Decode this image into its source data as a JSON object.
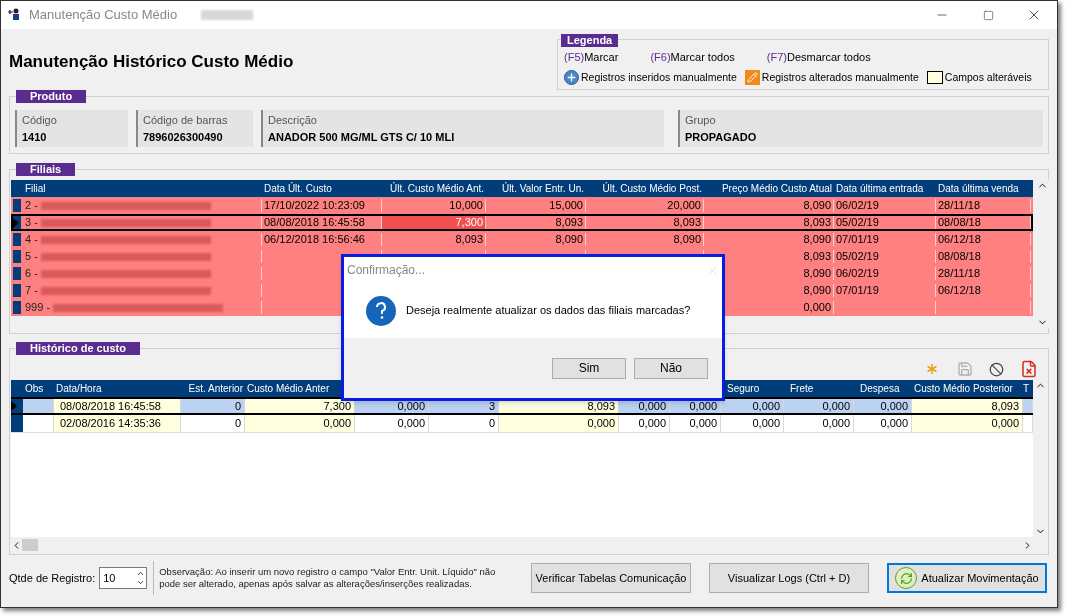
{
  "window": {
    "title": "Manutenção Custo Médio",
    "user_blurred": true
  },
  "heading": "Manutenção Histórico Custo Médio",
  "legend": {
    "title": "Legenda",
    "shortcuts": [
      {
        "key": "(F5)",
        "label": "Marcar"
      },
      {
        "key": "(F6)",
        "label": "Marcar todos"
      },
      {
        "key": "(F7)",
        "label": "Desmarcar todos"
      }
    ],
    "items": [
      {
        "kind": "inserted",
        "label": "Registros inseridos manualmente"
      },
      {
        "kind": "altered",
        "label": "Registros alterados manualmente"
      },
      {
        "kind": "editable",
        "label": "Campos alteráveis"
      }
    ]
  },
  "produto": {
    "title": "Produto",
    "fields": [
      {
        "label": "Código",
        "value": "1410"
      },
      {
        "label": "Código de barras",
        "value": "7896026300490"
      },
      {
        "label": "Descrição",
        "value": "ANADOR 500 MG/ML GTS C/ 10 MLI"
      },
      {
        "label": "Grupo",
        "value": "PROPAGADO"
      }
    ]
  },
  "filiais": {
    "title": "Filiais",
    "columns": [
      "Filial",
      "Data Últ. Custo",
      "Últ. Custo Médio Ant.",
      "Últ. Valor Entr. Un.",
      "Últ. Custo Médio Post.",
      "Preço Médio Custo Atual",
      "Data última entrada",
      "Data última venda"
    ],
    "rows": [
      {
        "selected": false,
        "marked": true,
        "name_blurred": true,
        "cells": [
          "2 -",
          "17/10/2022 10:23:09",
          "10,000",
          "15,000",
          "20,000",
          "8,090",
          "06/02/19",
          "28/11/18"
        ]
      },
      {
        "selected": true,
        "marked": true,
        "name_blurred": true,
        "cells": [
          "3 -",
          "08/08/2018 16:45:58",
          {
            "text": "7,300",
            "changed": true
          },
          "8,093",
          "8,093",
          "8,093",
          "05/02/19",
          "08/08/18"
        ]
      },
      {
        "selected": false,
        "marked": true,
        "name_blurred": true,
        "cells": [
          "4 -",
          "06/12/2018 16:56:46",
          "8,093",
          "8,090",
          "8,090",
          "8,090",
          "07/01/19",
          "06/12/18"
        ]
      },
      {
        "selected": false,
        "marked": true,
        "name_blurred": true,
        "cells": [
          "5 -",
          null,
          null,
          null,
          null,
          "8,093",
          "05/02/19",
          "08/08/18"
        ]
      },
      {
        "selected": false,
        "marked": true,
        "name_blurred": true,
        "cells": [
          "6 -",
          null,
          null,
          null,
          null,
          "8,090",
          "06/02/19",
          "28/11/18"
        ]
      },
      {
        "selected": false,
        "marked": true,
        "name_blurred": true,
        "cells": [
          "7 -",
          null,
          null,
          null,
          null,
          "8,090",
          "07/01/19",
          "06/12/18"
        ]
      },
      {
        "selected": false,
        "marked": true,
        "name_blurred": true,
        "cells": [
          "999 -",
          null,
          null,
          null,
          null,
          "0,000",
          null,
          null
        ]
      }
    ]
  },
  "historico": {
    "title": "Histórico de custo",
    "toolbar": [
      {
        "kind": "new",
        "disabled": false
      },
      {
        "kind": "save",
        "disabled": true
      },
      {
        "kind": "cancel",
        "disabled": false
      },
      {
        "kind": "delete",
        "disabled": false
      }
    ],
    "columns": [
      {
        "label": "Obs",
        "editable": false
      },
      {
        "label": "Data/Hora",
        "editable": true
      },
      {
        "label": "Est. Anterior",
        "editable": false
      },
      {
        "label": "Custo Médio Anter",
        "editable": true
      },
      {
        "editable": false
      },
      {
        "editable": false
      },
      {
        "editable": true
      },
      {
        "editable": false
      },
      {
        "editable": false
      },
      {
        "label": "Seguro",
        "editable": false
      },
      {
        "label": "Frete",
        "editable": false
      },
      {
        "label": "Despesa",
        "editable": false
      },
      {
        "label": "Custo Médio Posterior",
        "editable": true
      },
      {
        "label": "T",
        "editable": false
      }
    ],
    "rows": [
      {
        "selected": true,
        "cells": [
          null,
          "08/08/2018 16:45:58",
          "0",
          "7,300",
          "0,000",
          "3",
          "8,093",
          "0,000",
          "0,000",
          "0,000",
          "0,000",
          "0,000",
          "8,093",
          null
        ]
      },
      {
        "selected": false,
        "cells": [
          null,
          "02/08/2016 14:35:36",
          "0",
          "0,000",
          "0,000",
          "0",
          "0,000",
          "0,000",
          "0,000",
          "0,000",
          "0,000",
          "0,000",
          "0,000",
          null
        ]
      }
    ]
  },
  "footer": {
    "qtde_label": "Qtde de Registro:",
    "qtde_value": "10",
    "note": "Observação:  Ao inserir um novo registro o campo \"Valor Entr. Unit. Líquido\" não pode ser alterado, apenas após salvar as alterações/inserções realizadas.",
    "buttons": [
      {
        "label": "Verificar Tabelas Comunicação",
        "kind": "plain",
        "focused": false
      },
      {
        "label": "Visualizar Logs (Ctrl + D)",
        "kind": "plain",
        "focused": false
      },
      {
        "label": "Atualizar Movimentação",
        "kind": "refresh",
        "focused": true
      }
    ]
  },
  "dialog": {
    "title": "Confirmação...",
    "message": "Deseja realmente atualizar os dados das filiais marcadas?",
    "buttons": [
      "Sim",
      "Não"
    ]
  }
}
